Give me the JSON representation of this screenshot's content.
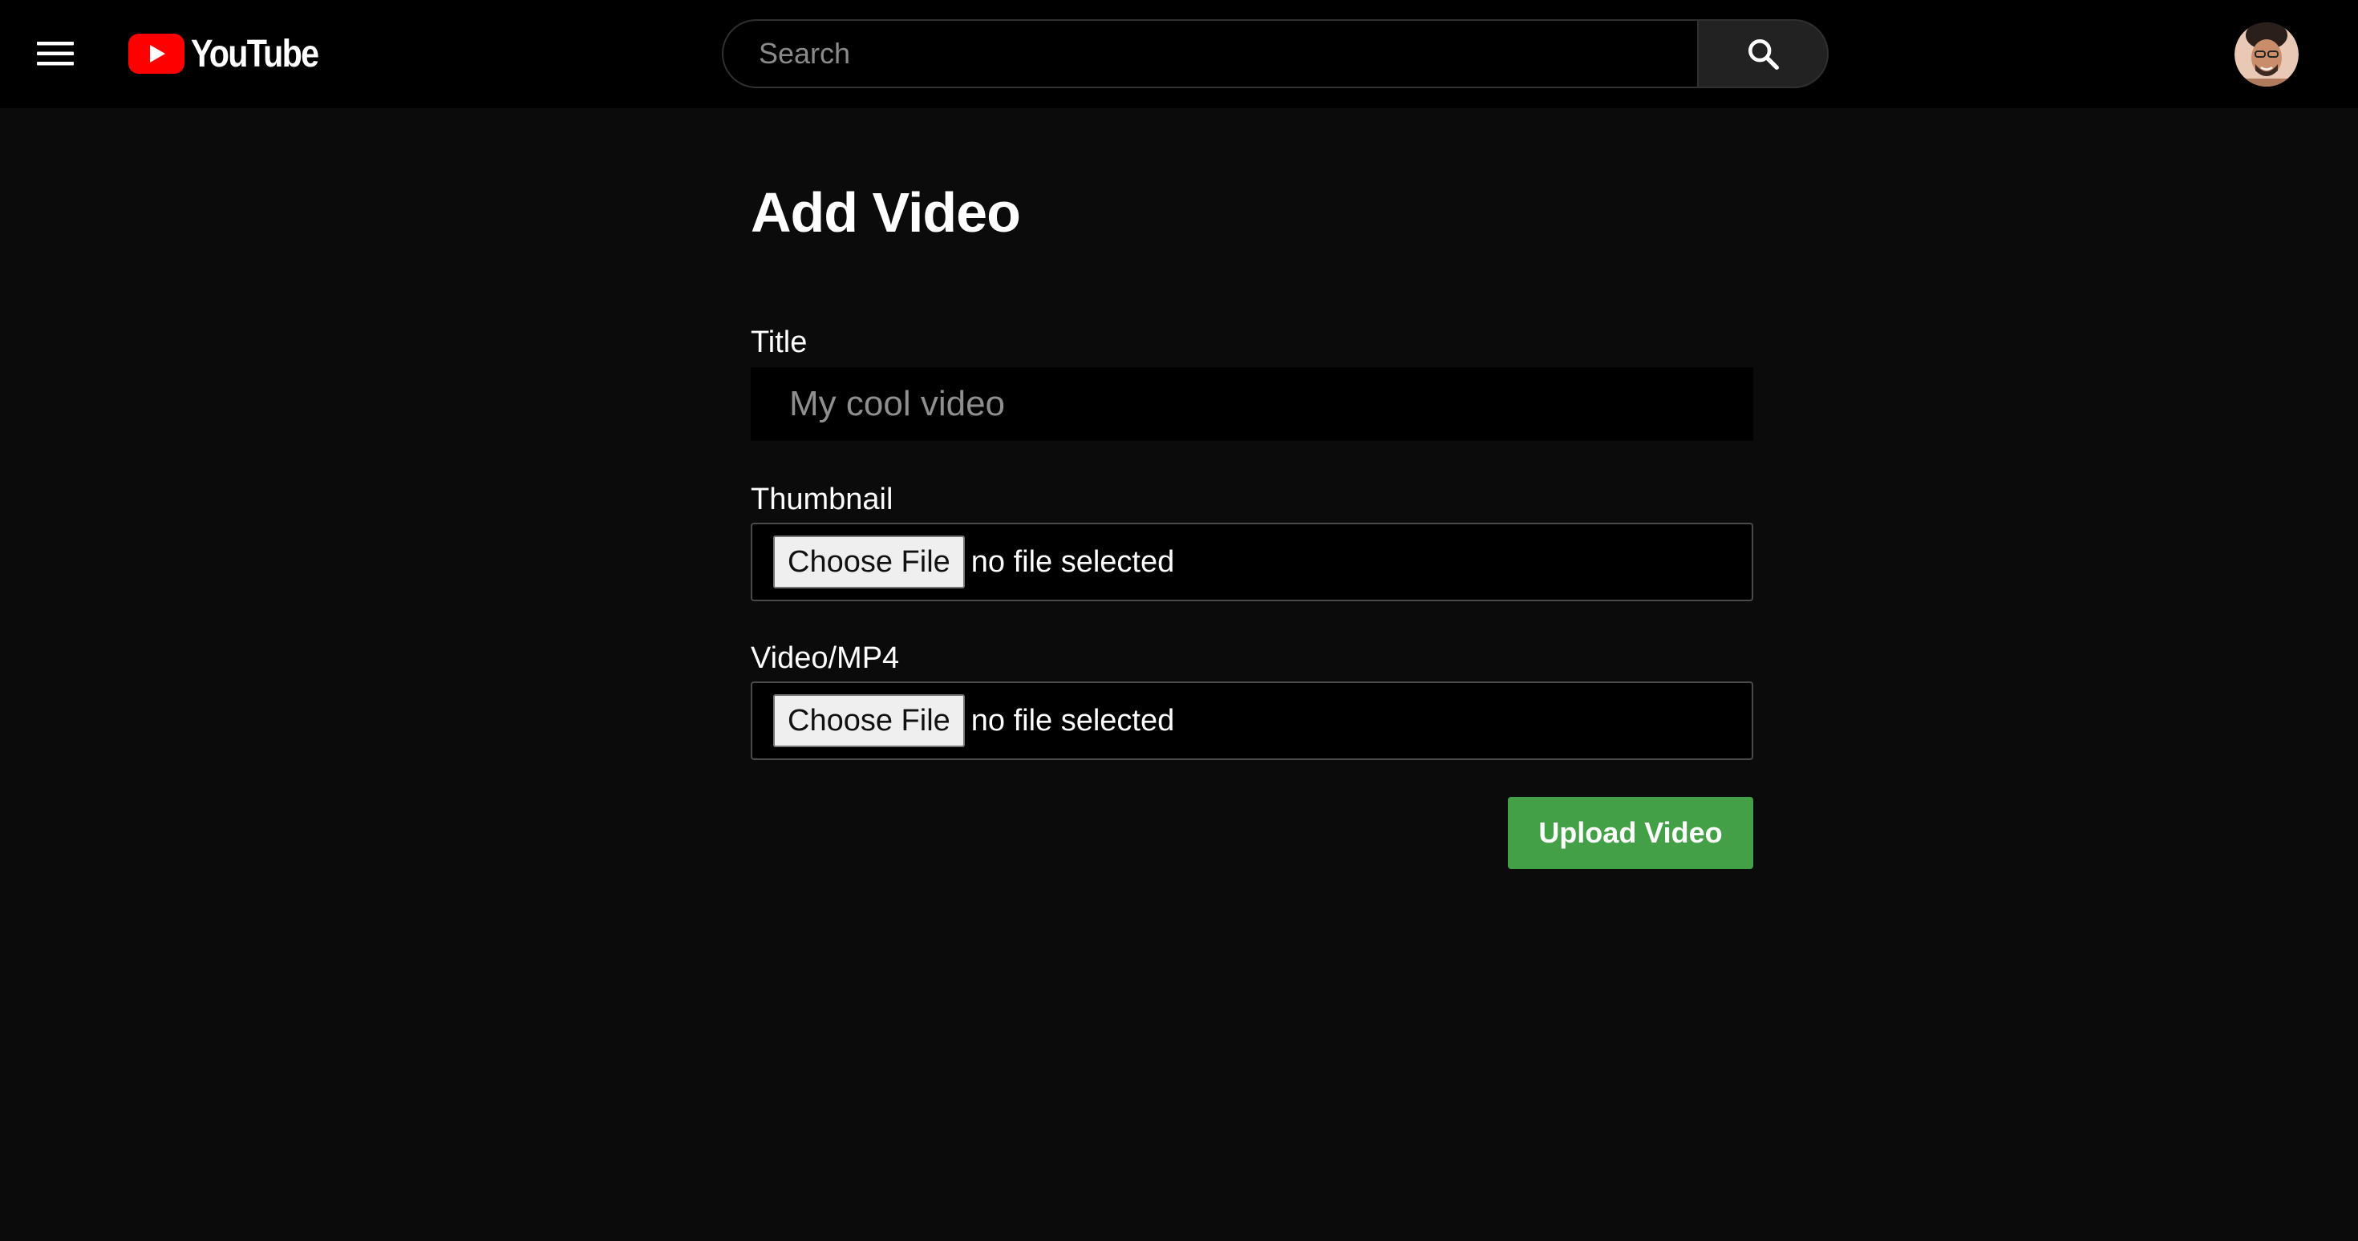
{
  "header": {
    "logo_text": "YouTube",
    "search_placeholder": "Search",
    "icons": {
      "menu": "hamburger-menu-icon",
      "logo": "youtube-play-icon",
      "search": "magnifier-icon",
      "avatar": "user-avatar"
    },
    "colors": {
      "brand_red": "#FF0000",
      "topbar_bg": "#000000"
    }
  },
  "form": {
    "heading": "Add Video",
    "title_field": {
      "label": "Title",
      "placeholder": "My cool video",
      "value": ""
    },
    "thumbnail_field": {
      "label": "Thumbnail",
      "button_label": "Choose File",
      "status": "no file selected"
    },
    "video_field": {
      "label": "Video/MP4",
      "button_label": "Choose File",
      "status": "no file selected"
    },
    "submit_label": "Upload Video",
    "colors": {
      "submit_bg": "#43A047",
      "page_bg": "#0B0B0B"
    }
  }
}
